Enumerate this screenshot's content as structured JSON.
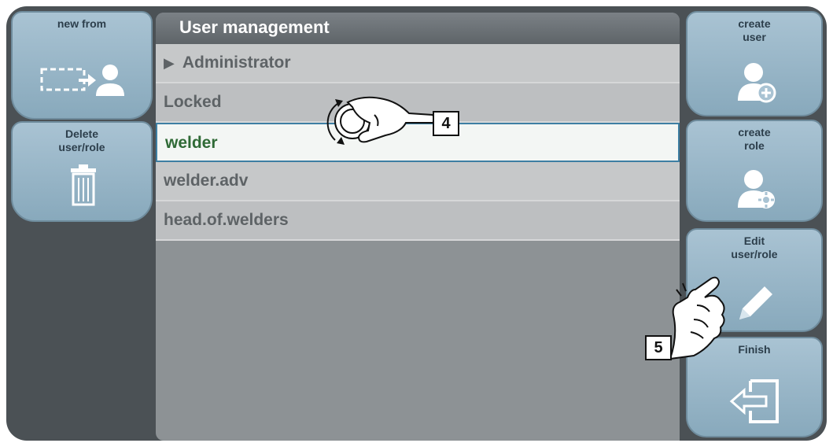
{
  "left_buttons": {
    "new_from": "new from",
    "delete": "Delete\nuser/role"
  },
  "right_buttons": {
    "create_user": "create\nuser",
    "create_role": "create\nrole",
    "edit": "Edit\nuser/role",
    "finish": "Finish"
  },
  "panel": {
    "title": "User management",
    "items": [
      {
        "label": "Administrator"
      },
      {
        "label": "Locked"
      },
      {
        "label": "welder"
      },
      {
        "label": "welder.adv"
      },
      {
        "label": "head.of.welders"
      }
    ]
  },
  "annotations": {
    "step4": "4",
    "step5": "5"
  },
  "colors": {
    "button_face": "#a9c3d3",
    "panel_bg": "#8d9295",
    "selected_text": "#2f6a36",
    "selected_border": "#3e7fa3"
  }
}
